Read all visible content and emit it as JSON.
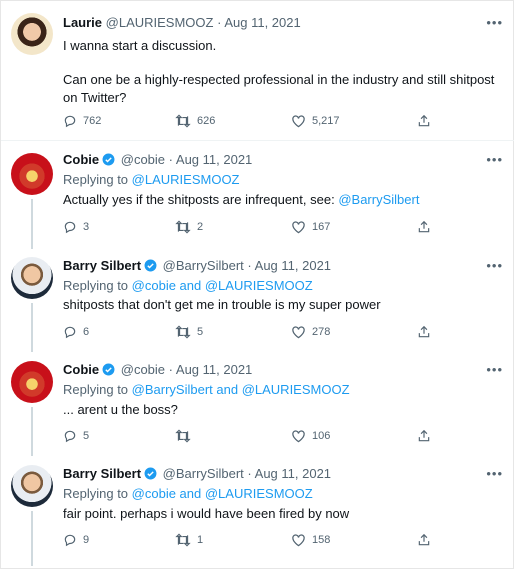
{
  "tweets": [
    {
      "name": "Laurie",
      "handle": "@LAURIESMOOZ",
      "date": "Aug 11, 2021",
      "verified": false,
      "text_lines": [
        "I wanna start a discussion.",
        "",
        "Can one be a highly-respected professional in the industry and still shitpost",
        "on Twitter?"
      ],
      "replies": "762",
      "retweets": "626",
      "likes": "5,217"
    },
    {
      "name": "Cobie",
      "handle": "@cobie",
      "date": "Aug 11, 2021",
      "verified": true,
      "replying_label": "Replying to",
      "replying_to": "@LAURIESMOOZ",
      "text": "Actually yes if the shitposts are infrequent, see:",
      "text_mention": "@BarrySilbert",
      "replies": "3",
      "retweets": "2",
      "likes": "167"
    },
    {
      "name": "Barry Silbert",
      "handle": "@BarrySilbert",
      "date": "Aug 11, 2021",
      "verified": true,
      "replying_label": "Replying to",
      "replying_to": "@cobie and @LAURIESMOOZ",
      "text": "shitposts that don't get me in trouble is my super power",
      "replies": "6",
      "retweets": "5",
      "likes": "278"
    },
    {
      "name": "Cobie",
      "handle": "@cobie",
      "date": "Aug 11, 2021",
      "verified": true,
      "replying_label": "Replying to",
      "replying_to": "@BarrySilbert and @LAURIESMOOZ",
      "text": "... arent u the boss?",
      "replies": "5",
      "retweets": "",
      "likes": "106"
    },
    {
      "name": "Barry Silbert",
      "handle": "@BarrySilbert",
      "date": "Aug 11, 2021",
      "verified": true,
      "replying_label": "Replying to",
      "replying_to": "@cobie and @LAURIESMOOZ",
      "text": "fair point. perhaps i would have been fired by now",
      "replies": "9",
      "retweets": "1",
      "likes": "158"
    }
  ],
  "separator_dot": "·",
  "more_glyph": "•••",
  "colors": {
    "accent": "#1d9bf0",
    "muted": "#536471",
    "text": "#0f1419"
  },
  "icons": {
    "reply": "reply-icon",
    "retweet": "retweet-icon",
    "like": "heart-icon",
    "share": "share-icon",
    "verified": "verified-badge-icon",
    "more": "more-icon"
  }
}
